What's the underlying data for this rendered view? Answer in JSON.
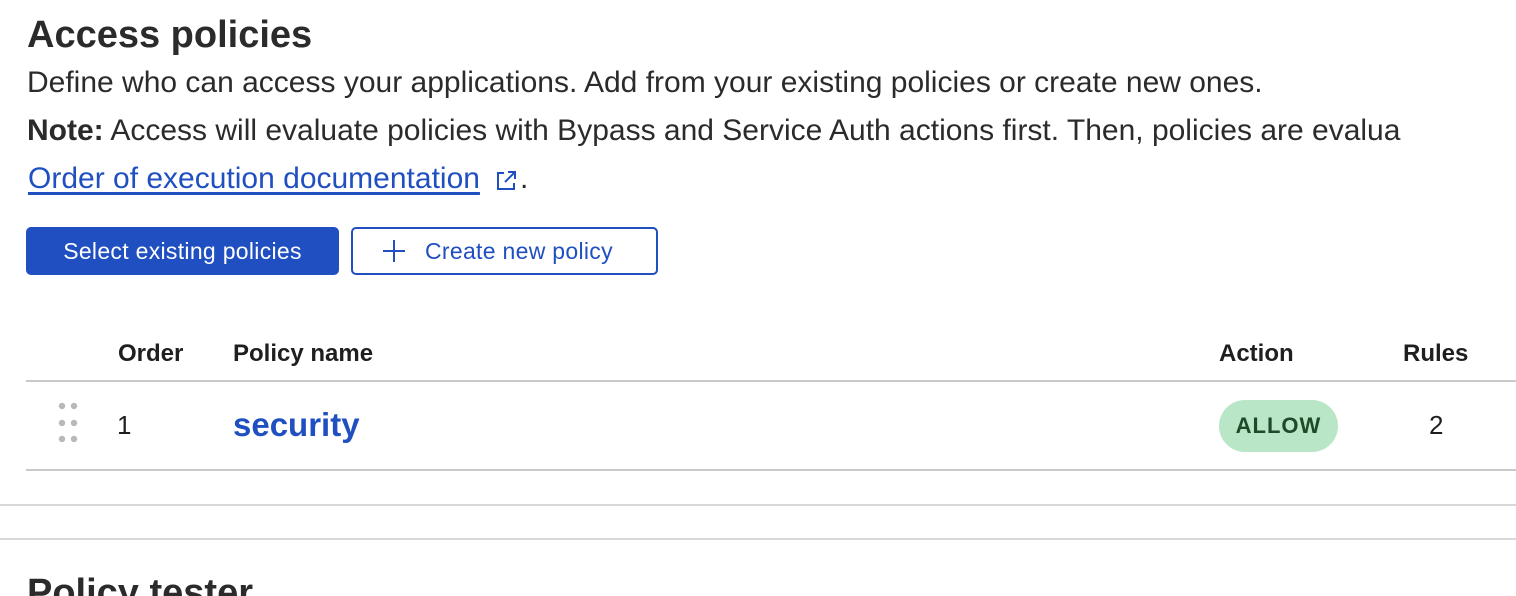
{
  "access_policies": {
    "title": "Access policies",
    "description": "Define who can access your applications. Add from your existing policies or create new ones.",
    "note_label": "Note:",
    "note_text": " Access will evaluate policies with Bypass and Service Auth actions first. Then, policies are evalua",
    "doc_link": "Order of execution documentation",
    "doc_link_icon": "external-link-icon",
    "doc_trailing": "."
  },
  "buttons": {
    "select_existing": "Select existing policies",
    "create_new": "Create new policy",
    "create_new_icon": "plus-icon"
  },
  "table": {
    "headers": {
      "order": "Order",
      "policy_name": "Policy name",
      "action": "Action",
      "rules": "Rules"
    },
    "rows": [
      {
        "order": "1",
        "policy_name": "security",
        "action": "ALLOW",
        "rules": "2"
      }
    ]
  },
  "next_section": {
    "title": "Policy tester"
  },
  "colors": {
    "accent": "#1f4fc0",
    "allow_badge_bg": "#b9e6c6",
    "allow_badge_text": "#1e4a2a"
  }
}
